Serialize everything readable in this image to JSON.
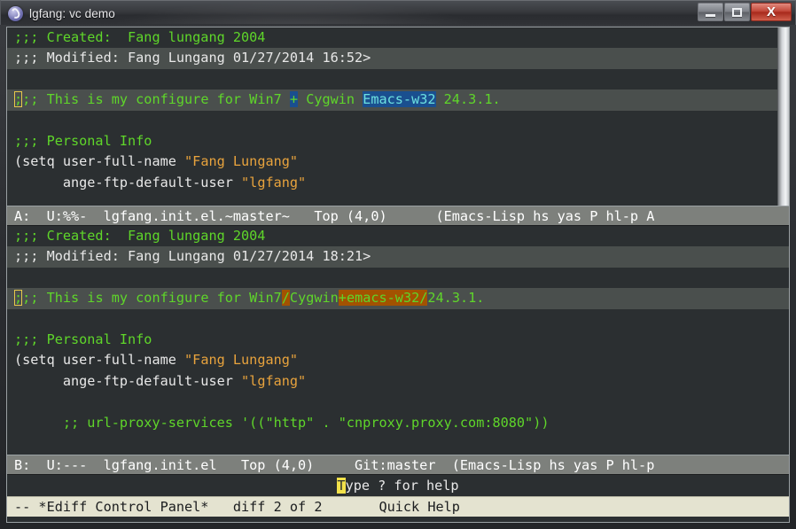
{
  "titlebar": {
    "title": "lgfang: vc demo",
    "icon": "emacs-icon",
    "minimize_label": "",
    "maximize_label": "",
    "close_label": "X"
  },
  "buffer_a": {
    "lines": [
      {
        "segments": [
          {
            "text": ";;; Created:  Fang lungang 2004",
            "style": "green"
          }
        ],
        "row_highlight": false
      },
      {
        "segments": [
          {
            "text": ";;; Modified: Fang Lungang 01/27/2014 16:52>",
            "style": "white"
          }
        ],
        "row_highlight": true
      },
      {
        "segments": [
          {
            "text": "",
            "style": "green"
          }
        ],
        "row_highlight": false
      },
      {
        "segments": [
          {
            "text": ";",
            "style": "green cursor-hollow"
          },
          {
            "text": ";; This is my configure for Win7 ",
            "style": "green"
          },
          {
            "text": "+",
            "style": "green hl-blue"
          },
          {
            "text": " Cygwin ",
            "style": "green"
          },
          {
            "text": "Emacs-w32",
            "style": "cyan hl-blue"
          },
          {
            "text": " 24.3.1.",
            "style": "green"
          }
        ],
        "row_highlight": true
      },
      {
        "segments": [
          {
            "text": "",
            "style": "green"
          }
        ],
        "row_highlight": false
      },
      {
        "segments": [
          {
            "text": ";;; Personal Info",
            "style": "green"
          }
        ],
        "row_highlight": false
      },
      {
        "segments": [
          {
            "text": "(setq user-full-name ",
            "style": "white"
          },
          {
            "text": "\"Fang Lungang\"",
            "style": "str"
          }
        ],
        "row_highlight": false
      },
      {
        "segments": [
          {
            "text": "      ange-ftp-default-user ",
            "style": "white"
          },
          {
            "text": "\"lgfang\"",
            "style": "str"
          }
        ],
        "row_highlight": false
      }
    ],
    "modeline": "A:  U:%%-  lgfang.init.el.~master~   Top (4,0)      (Emacs-Lisp hs yas P hl-p A"
  },
  "buffer_b": {
    "lines": [
      {
        "segments": [
          {
            "text": ";;; Created:  Fang lungang 2004",
            "style": "green"
          }
        ],
        "row_highlight": false
      },
      {
        "segments": [
          {
            "text": ";;; Modified: Fang Lungang 01/27/2014 18:21>",
            "style": "white"
          }
        ],
        "row_highlight": true
      },
      {
        "segments": [
          {
            "text": "",
            "style": "green"
          }
        ],
        "row_highlight": false
      },
      {
        "segments": [
          {
            "text": ";",
            "style": "green cursor-hollow"
          },
          {
            "text": ";; This is my configure for Win7",
            "style": "green"
          },
          {
            "text": "/",
            "style": "green hl-orange"
          },
          {
            "text": "Cygwin",
            "style": "green"
          },
          {
            "text": "+emacs-w32/",
            "style": "green hl-orange"
          },
          {
            "text": "24.3.1.",
            "style": "green"
          }
        ],
        "row_highlight": true
      },
      {
        "segments": [
          {
            "text": "",
            "style": "green"
          }
        ],
        "row_highlight": false
      },
      {
        "segments": [
          {
            "text": ";;; Personal Info",
            "style": "green"
          }
        ],
        "row_highlight": false
      },
      {
        "segments": [
          {
            "text": "(setq user-full-name ",
            "style": "white"
          },
          {
            "text": "\"Fang Lungang\"",
            "style": "str"
          }
        ],
        "row_highlight": false
      },
      {
        "segments": [
          {
            "text": "      ange-ftp-default-user ",
            "style": "white"
          },
          {
            "text": "\"lgfang\"",
            "style": "str"
          }
        ],
        "row_highlight": false
      },
      {
        "segments": [
          {
            "text": "",
            "style": "green"
          }
        ],
        "row_highlight": false
      },
      {
        "segments": [
          {
            "text": "      ;; url-proxy-services '((\"http\" . \"cnproxy.proxy.com:8080\"))",
            "style": "green"
          }
        ],
        "row_highlight": false
      }
    ],
    "modeline": "B:  U:---  lgfang.init.el   Top (4,0)     Git:master  (Emacs-Lisp hs yas P hl-p"
  },
  "ediff_panel": {
    "prompt_cursor_char": "T",
    "prompt_rest": "ype ? for help",
    "modeline": "-- *Ediff Control Panel*   diff 2 of 2       Quick Help"
  },
  "colors": {
    "comment_green": "#5fd62a",
    "string_orange": "#e8a33d",
    "text_white": "#e8e8e8",
    "background": "#2b2f31",
    "diff_region": "#4a4f4d",
    "fine_diff_a": "#1a4f8f",
    "fine_diff_b": "#a35200",
    "cursor_yellow": "#f2e14a",
    "modeline_inactive": "#7d807c",
    "modeline_active": "#e4e3d0"
  }
}
